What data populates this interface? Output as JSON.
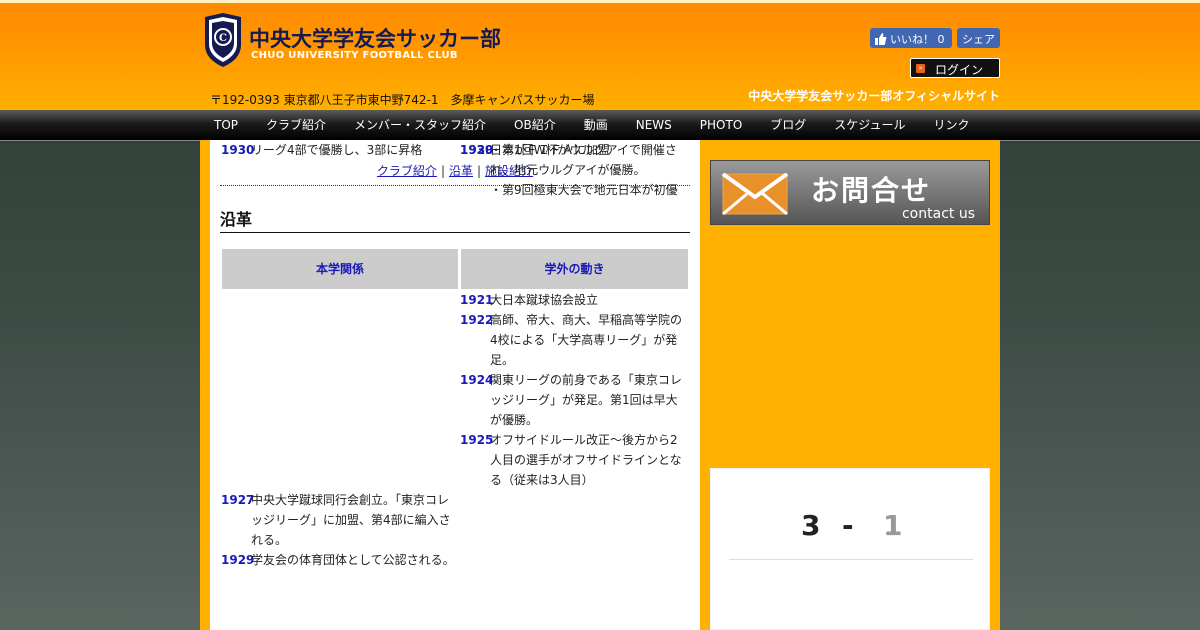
{
  "header": {
    "club_name_jp": "中央大学学友会サッカー部",
    "club_name_en": "CHUO UNIVERSITY FOOTBALL CLUB",
    "address": "〒192-0393 東京都八王子市東中野742-1　多摩キャンパスサッカー場",
    "site_title": "中央大学学友会サッカー部オフィシャルサイト",
    "fb_like_label": "いいね！ 0",
    "fb_share_label": "シェア",
    "login_label": "ログイン"
  },
  "nav": {
    "items": [
      "TOP",
      "クラブ紹介",
      "メンバー・スタッフ紹介",
      "OB紹介",
      "動画",
      "NEWS",
      "PHOTO",
      "ブログ",
      "スケジュール",
      "リンク"
    ]
  },
  "sub_links": [
    "クラブ紹介",
    "沿革",
    "施設紹介"
  ],
  "section_title": "沿革",
  "table": {
    "headers": [
      "本学関係",
      "学外の動き"
    ],
    "rows": [
      {
        "side": "outside",
        "year": "1921",
        "lines": [
          "大日本蹴球協会設立"
        ]
      },
      {
        "side": "outside",
        "year": "1922",
        "lines": [
          "高師、帝大、商大、早稲高等学院の",
          "4校による「大学高専リーグ」が発",
          "足。"
        ]
      },
      {
        "side": "outside",
        "year": "1924",
        "lines": [
          "関東リーグの前身である「東京コレ",
          "ッジリーグ」が発足。第1回は早大",
          "が優勝。"
        ]
      },
      {
        "side": "outside",
        "year": "1925",
        "lines": [
          "オフサイドルール改正～後方から2",
          "人目の選手がオフサイドラインとな",
          "る（従来は3人目）"
        ]
      },
      {
        "side": "inside",
        "year": "1927",
        "lines": [
          "中央大学蹴球同行会創立。「東京コレ",
          "ッジリーグ」に加盟、第4部に編入さ",
          "れる。"
        ]
      },
      {
        "side": "inside",
        "year": "1929",
        "lines": [
          "学友会の体育団体として公認される。"
        ]
      },
      {
        "side": "outside",
        "year": "1929",
        "lines": [
          "日本がＦＩＦＡに加盟"
        ]
      },
      {
        "side": "inside",
        "year": "1930",
        "lines": [
          "リーグ4部で優勝し、3部に昇格"
        ]
      },
      {
        "side": "outside",
        "year": "1930",
        "lines": [
          "・第1回W杯がウルグアイで開催さ",
          "れ、地元ウルグアイが優勝。",
          "・第9回極東大会で地元日本が初優"
        ]
      }
    ]
  },
  "sidebar": {
    "contact_jp": "お問合せ",
    "contact_en": "contact us",
    "score": {
      "home": "3",
      "separator": "-",
      "away": "1"
    }
  },
  "colors": {
    "header_orange": "#ff8a00",
    "page_orange": "#ffb000",
    "link_blue": "#1a1abb",
    "fb_blue": "#4267b2"
  }
}
